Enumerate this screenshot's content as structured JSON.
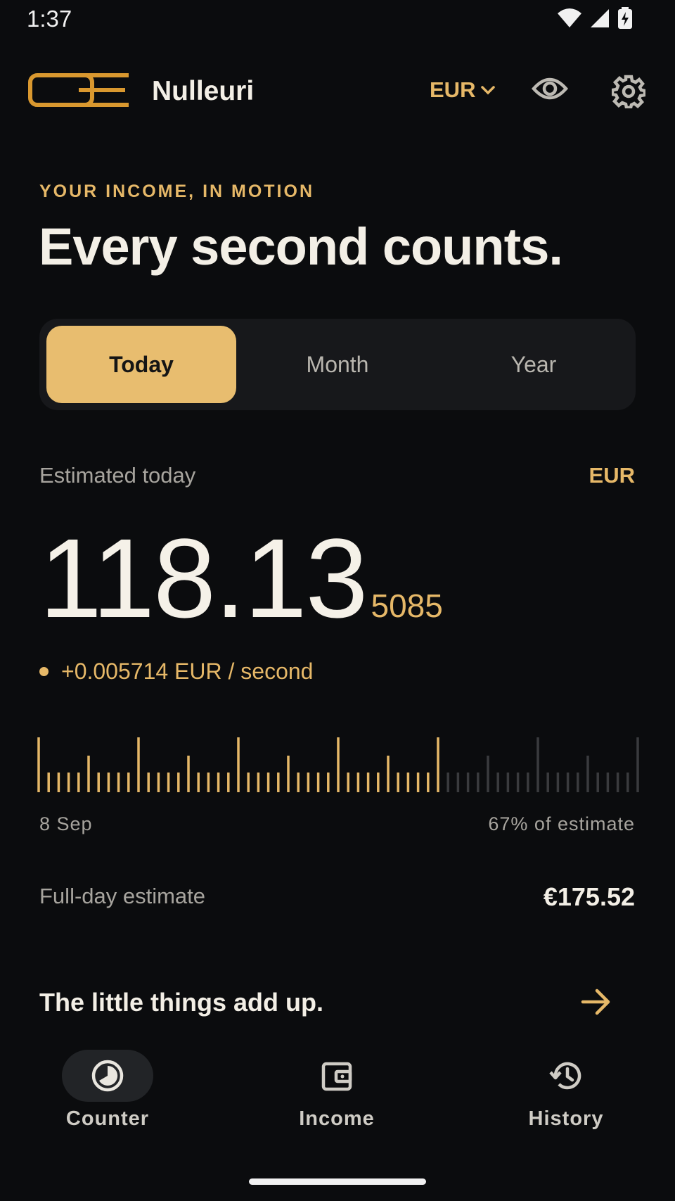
{
  "status_bar": {
    "time": "1:37"
  },
  "header": {
    "app_name": "Nulleuri",
    "currency": "EUR"
  },
  "hero": {
    "eyebrow": "YOUR INCOME, IN MOTION",
    "headline": "Every second counts."
  },
  "tabs": [
    {
      "label": "Today",
      "active": true
    },
    {
      "label": "Month",
      "active": false
    },
    {
      "label": "Year",
      "active": false
    }
  ],
  "counter": {
    "label": "Estimated today",
    "currency": "EUR",
    "amount_main": "118.13",
    "amount_fraction": "5085",
    "rate": "+0.005714 EUR / second"
  },
  "progress": {
    "date": "8 Sep",
    "percent_text": "67% of estimate",
    "fraction": 0.67
  },
  "full_day": {
    "label": "Full-day estimate",
    "value": "€175.52"
  },
  "promo": {
    "text": "The little things add up."
  },
  "nav": [
    {
      "label": "Counter",
      "icon": "clock-icon",
      "active": true
    },
    {
      "label": "Income",
      "icon": "wallet-icon",
      "active": false
    },
    {
      "label": "History",
      "icon": "history-icon",
      "active": false
    }
  ],
  "colors": {
    "accent": "#e6b868",
    "background": "#0b0c0e",
    "tick_inactive": "#3a3b3e"
  }
}
